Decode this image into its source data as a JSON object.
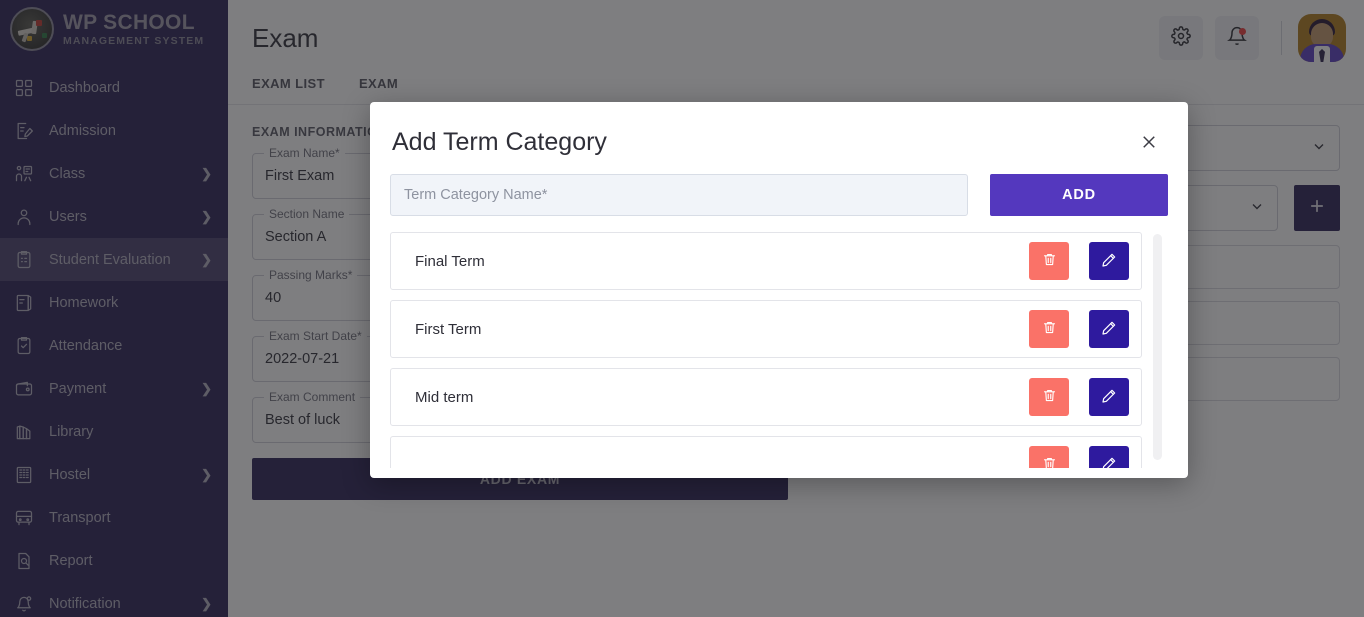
{
  "brand": {
    "title": "WP SCHOOL",
    "subtitle": "MANAGEMENT SYSTEM",
    "sidebar_bg": "#2d2257"
  },
  "sidebar": {
    "items": [
      {
        "label": "Dashboard",
        "icon": "grid-icon",
        "expandable": false,
        "active": false
      },
      {
        "label": "Admission",
        "icon": "form-edit-icon",
        "expandable": false,
        "active": false
      },
      {
        "label": "Class",
        "icon": "classroom-icon",
        "expandable": true,
        "active": false
      },
      {
        "label": "Users",
        "icon": "user-icon",
        "expandable": true,
        "active": false
      },
      {
        "label": "Student Evaluation",
        "icon": "clipboard-icon",
        "expandable": true,
        "active": true
      },
      {
        "label": "Homework",
        "icon": "book-icon",
        "expandable": false,
        "active": false
      },
      {
        "label": "Attendance",
        "icon": "checklist-icon",
        "expandable": false,
        "active": false
      },
      {
        "label": "Payment",
        "icon": "wallet-icon",
        "expandable": true,
        "active": false
      },
      {
        "label": "Library",
        "icon": "books-icon",
        "expandable": false,
        "active": false
      },
      {
        "label": "Hostel",
        "icon": "building-icon",
        "expandable": true,
        "active": false
      },
      {
        "label": "Transport",
        "icon": "bus-icon",
        "expandable": false,
        "active": false
      },
      {
        "label": "Report",
        "icon": "report-icon",
        "expandable": false,
        "active": false
      },
      {
        "label": "Notification",
        "icon": "bell-icon",
        "expandable": true,
        "active": false
      }
    ]
  },
  "header": {
    "title": "Exam",
    "settings_icon": "gear-icon",
    "notification_icon": "bell-icon",
    "has_notification_dot": true,
    "avatar_icon": "avatar"
  },
  "tabs": [
    {
      "label": "EXAM LIST"
    },
    {
      "label": "EXAM"
    }
  ],
  "exam_form": {
    "section_heading": "EXAM INFORMATION",
    "fields": [
      {
        "label": "Exam Name*",
        "value": "First Exam"
      },
      {
        "label": "Section Name",
        "value": "Section A"
      },
      {
        "label": "Passing Marks*",
        "value": "40"
      },
      {
        "label": "Exam Start Date*",
        "value": "2022-07-21"
      },
      {
        "label": "Exam Comment",
        "value": "Best of luck"
      }
    ],
    "submit_label": "ADD EXAM",
    "submit_color": "#2d2257"
  },
  "right_panel": {
    "selects": [
      {
        "value": "",
        "icon": "chevron-down-icon"
      },
      {
        "value": "",
        "icon": "chevron-down-icon"
      }
    ],
    "add_button_icon": "plus-icon",
    "add_button_color": "#2d2257",
    "placeholder_rows": 3
  },
  "modal": {
    "title": "Add Term Category",
    "close_icon": "close-icon",
    "input": {
      "value": "",
      "placeholder": "Term Category Name*"
    },
    "add_label": "ADD",
    "add_color": "#5438be",
    "delete_icon": "trash-icon",
    "edit_icon": "pencil-icon",
    "delete_color": "#fa7268",
    "edit_color": "#2e1a9e",
    "terms": [
      {
        "name": "Final Term"
      },
      {
        "name": "First Term"
      },
      {
        "name": "Mid term"
      },
      {
        "name": ""
      }
    ]
  }
}
